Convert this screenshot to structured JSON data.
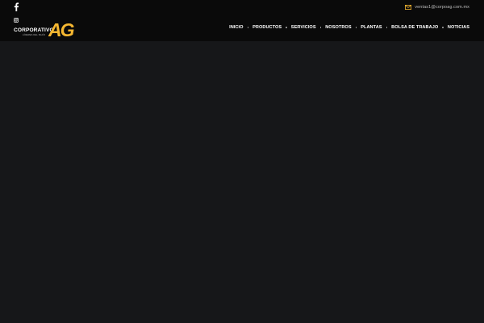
{
  "colors": {
    "topbar_bg": "#0a0a0a",
    "page_bg": "#161719",
    "accent": "#f5b731",
    "text": "#ffffff",
    "muted_text": "#bdbdbd"
  },
  "topbar": {
    "social_icons": [
      "facebook-icon",
      "instagram-icon"
    ],
    "contact_icon": "mail-icon",
    "email": "ventas1@corpoag.com.mx"
  },
  "brand": {
    "name": "CORPORATIVO",
    "tagline": "LÍDERES DEL BAJÍO",
    "monogram": "AG"
  },
  "nav": {
    "items": [
      {
        "label": "INICIO"
      },
      {
        "label": "PRODUCTOS"
      },
      {
        "label": "SERVICIOS"
      },
      {
        "label": "NOSOTROS"
      },
      {
        "label": "PLANTAS"
      },
      {
        "label": "BOLSA DE TRABAJO"
      },
      {
        "label": "NOTICIAS"
      }
    ]
  }
}
